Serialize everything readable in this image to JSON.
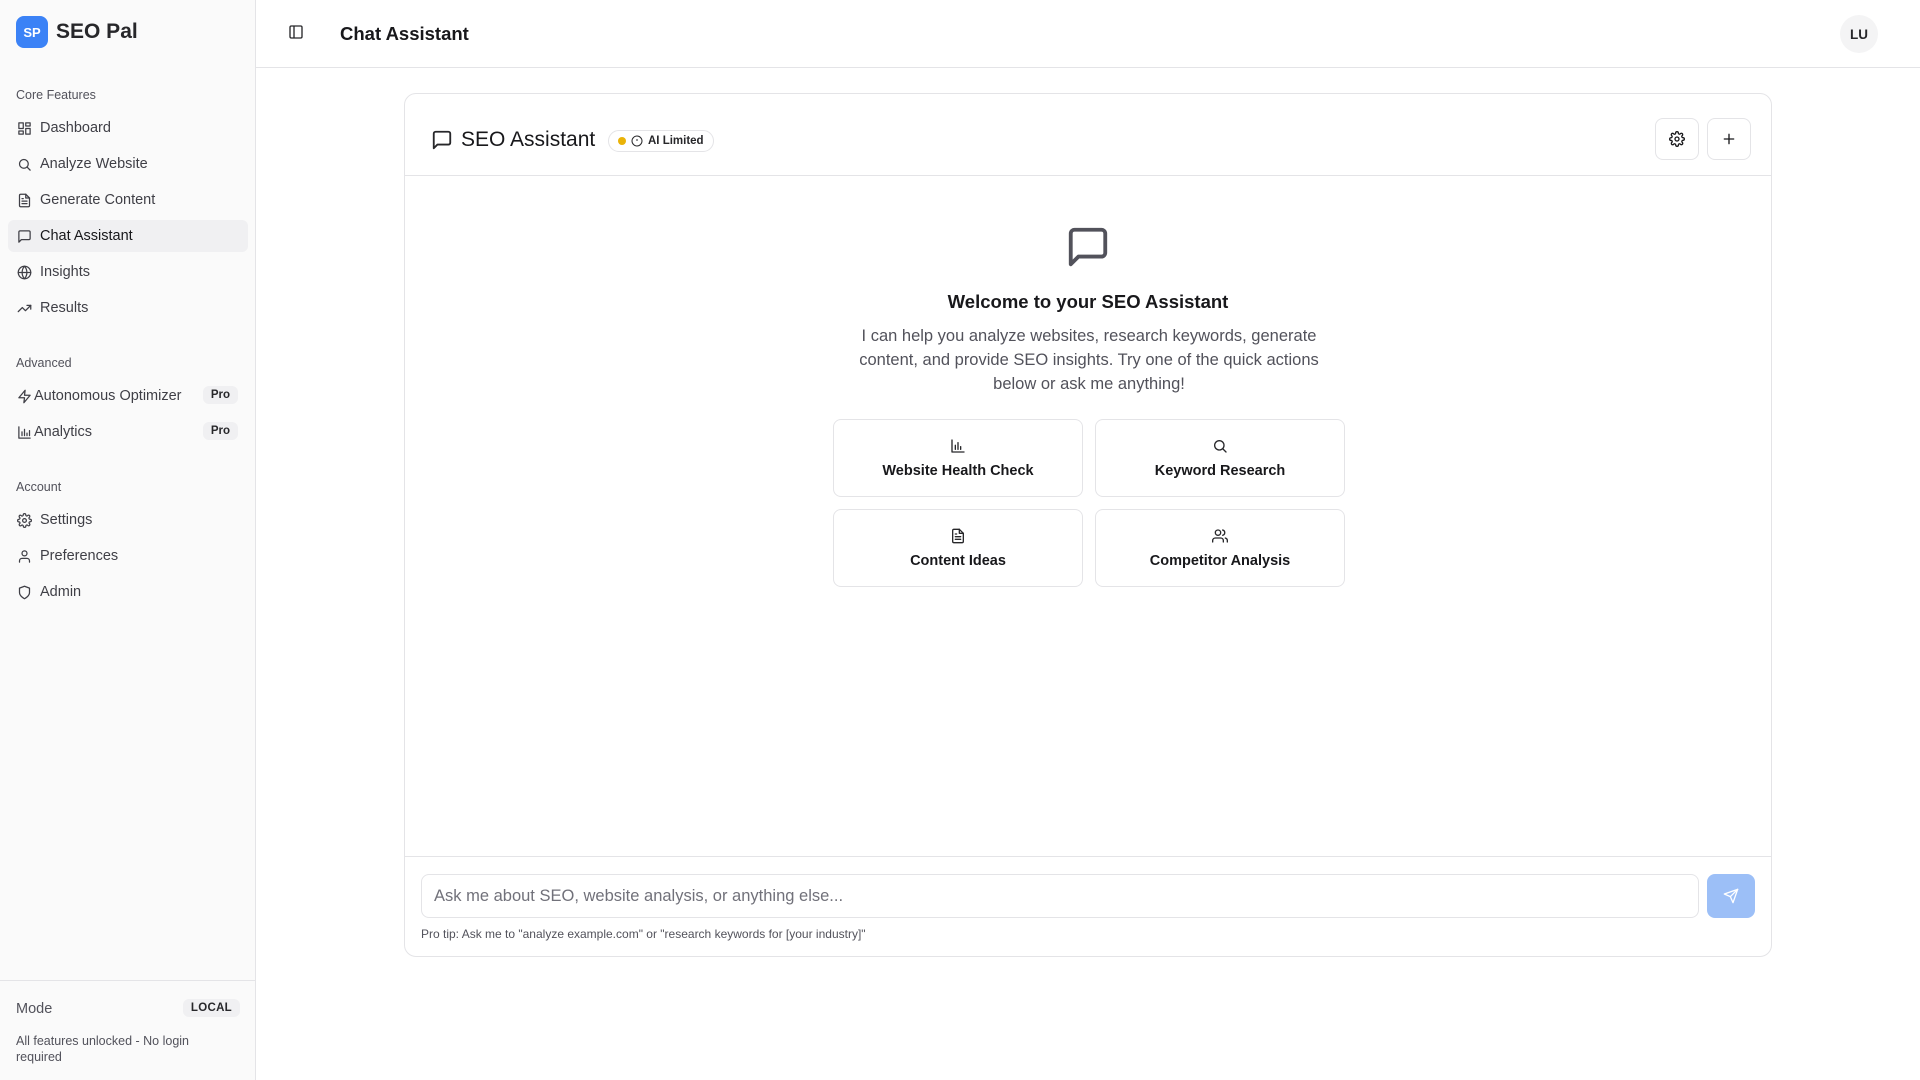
{
  "brand": {
    "logo_text": "SP",
    "name": "SEO Pal",
    "accent": "#3b82f6"
  },
  "sidebar": {
    "sections": [
      {
        "label": "Core Features"
      },
      {
        "label": "Advanced"
      },
      {
        "label": "Account"
      }
    ],
    "items": [
      {
        "label": "Dashboard",
        "icon": "dashboard-icon"
      },
      {
        "label": "Analyze Website",
        "icon": "search-icon"
      },
      {
        "label": "Generate Content",
        "icon": "file-text-icon"
      },
      {
        "label": "Chat Assistant",
        "icon": "message-square-icon",
        "active": true
      },
      {
        "label": "Insights",
        "icon": "globe-icon"
      },
      {
        "label": "Results",
        "icon": "trending-up-icon"
      },
      {
        "label": "Autonomous Optimizer",
        "icon": "zap-icon",
        "badge": "Pro"
      },
      {
        "label": "Analytics",
        "icon": "bar-chart-icon",
        "badge": "Pro"
      },
      {
        "label": "Settings",
        "icon": "gear-icon"
      },
      {
        "label": "Preferences",
        "icon": "user-icon"
      },
      {
        "label": "Admin",
        "icon": "shield-icon"
      }
    ],
    "footer": {
      "mode_label": "Mode",
      "mode_value": "LOCAL",
      "description": "All features unlocked - No login required"
    }
  },
  "header": {
    "title": "Chat Assistant",
    "avatar_initials": "LU"
  },
  "chat": {
    "title": "SEO Assistant",
    "status_badge": "AI Limited",
    "status_color": "#eab308",
    "welcome_title": "Welcome to your SEO Assistant",
    "welcome_text": "I can help you analyze websites, research keywords, generate content, and provide SEO insights. Try one of the quick actions below or ask me anything!",
    "quick_actions": [
      {
        "label": "Website Health Check",
        "icon": "bar-chart-icon"
      },
      {
        "label": "Keyword Research",
        "icon": "search-icon"
      },
      {
        "label": "Content Ideas",
        "icon": "file-text-icon"
      },
      {
        "label": "Competitor Analysis",
        "icon": "users-icon"
      }
    ],
    "input_placeholder": "Ask me about SEO, website analysis, or anything else...",
    "input_value": "",
    "pro_tip": "Pro tip: Ask me to \"analyze example.com\" or \"research keywords for [your industry]\"",
    "send_color": "#9cbff7"
  }
}
